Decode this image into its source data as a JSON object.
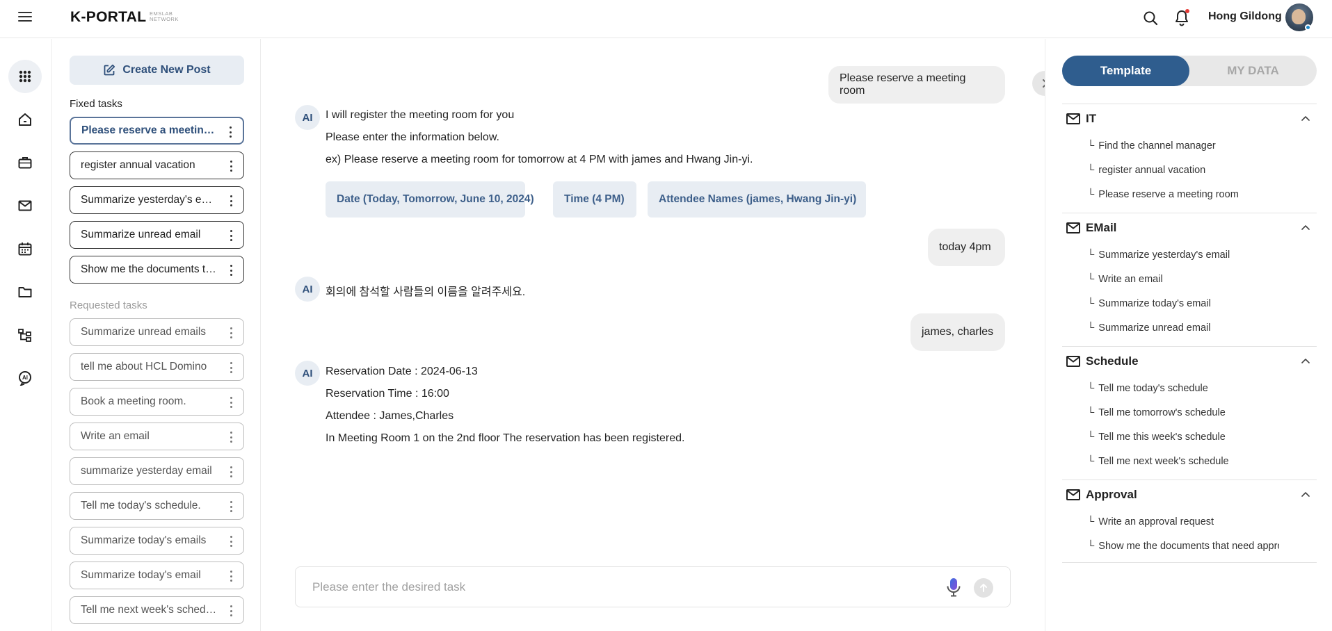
{
  "header": {
    "logo": "K-PORTAL",
    "logo_sub_1": "EMSLAB",
    "logo_sub_2": "NETWORK",
    "user_name": "Hong Gildong"
  },
  "rail": {
    "icons": [
      "apps-grid-icon",
      "home-icon",
      "briefcase-icon",
      "mail-icon",
      "calendar-icon",
      "folder-icon",
      "org-chart-icon",
      "ai-assistant-icon"
    ]
  },
  "sidebar": {
    "create_label": "Create New Post",
    "fixed_label": "Fixed tasks",
    "requested_label": "Requested tasks",
    "fixed": [
      "Please reserve a meeting room",
      "register annual vacation",
      "Summarize yesterday's email",
      "Summarize unread email",
      "Show me the documents that need approval"
    ],
    "requested": [
      "Summarize unread emails",
      "tell me about HCL Domino",
      "Book a meeting room.",
      "Write an email",
      "summarize yesterday email",
      "Tell me today's schedule.",
      "Summarize today's emails",
      "Summarize today's email",
      "Tell me next week's schedule"
    ]
  },
  "chat": {
    "ai_badge": "AI",
    "user_msg_1": "Please reserve a meeting room",
    "ai_msg_1": [
      "I will register the meeting room for you",
      "Please enter the information below.",
      "ex) Please reserve a meeting room for tomorrow at 4 PM with james and Hwang Jin-yi."
    ],
    "chips": [
      "Date (Today, Tomorrow, June 10, 2024)",
      "Time (4 PM)",
      "Attendee Names (james, Hwang Jin-yi)"
    ],
    "user_msg_2": "today 4pm",
    "ai_msg_2": "회의에 참석할 사람들의 이름을 알려주세요.",
    "user_msg_3": "james, charles",
    "ai_msg_3": [
      "Reservation Date : 2024-06-13",
      "Reservation Time : 16:00",
      "Attendee : James,Charles",
      "In Meeting Room 1 on the 2nd floor The reservation has been registered."
    ],
    "input_placeholder": "Please enter the desired task"
  },
  "panel": {
    "tab_template": "Template",
    "tab_mydata": "MY DATA",
    "categories": [
      {
        "title": "IT",
        "items": [
          "Find the channel manager",
          "register annual vacation",
          "Please reserve a meeting room"
        ]
      },
      {
        "title": "EMail",
        "items": [
          "Summarize yesterday's email",
          "Write an email",
          "Summarize today's email",
          "Summarize unread email"
        ]
      },
      {
        "title": "Schedule",
        "items": [
          "Tell me today's schedule",
          "Tell me tomorrow's schedule",
          "Tell me this week's schedule",
          "Tell me next week's schedule"
        ]
      },
      {
        "title": "Approval",
        "items": [
          "Write an approval request",
          "Show me the documents that need approval"
        ]
      }
    ]
  }
}
